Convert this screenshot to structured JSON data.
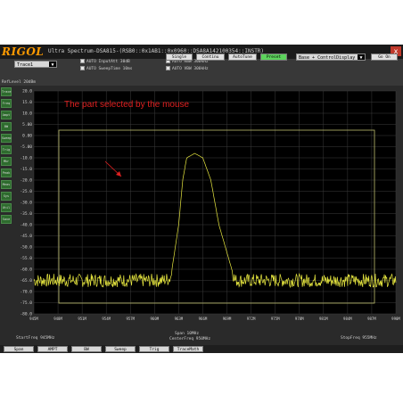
{
  "app": {
    "logo": "RIGOL",
    "title": "Ultra Spectrum-DSA815-(RSB0::0x1AB1::0x0960::DSA8A142100354::INSTR)",
    "close_label": "x"
  },
  "toolbar": {
    "trace_select": "Trace1",
    "buttons": [
      {
        "label": "Single",
        "active": false
      },
      {
        "label": "Continu",
        "active": false
      },
      {
        "label": "AutoTune",
        "active": false
      },
      {
        "label": "Preset",
        "active": true
      }
    ],
    "mode_select": "Base + ControlDisplay",
    "go_label": "Go On",
    "checks": [
      {
        "label": "AUTO InputAtt  30dB"
      },
      {
        "label": "AUTO SweepTime  10ms"
      },
      {
        "label": "AUTO RBW  300kHz"
      },
      {
        "label": "AUTO VBW  300kHz"
      }
    ]
  },
  "ref_level": "RefLevel  20dBm",
  "sidebar": {
    "items": [
      "Trace",
      "Freq",
      "Ampt",
      "BW",
      "Sweep",
      "Trig",
      "Mkr",
      "Peak",
      "Meas",
      "Sys",
      "Util",
      "Save"
    ]
  },
  "annotation": "The part selected by the mouse",
  "chart_data": {
    "type": "line",
    "title": "",
    "xlabel": "",
    "ylabel": "",
    "x_tick_labels": [
      "945M",
      "948M",
      "951M",
      "954M",
      "957M",
      "960M",
      "963M",
      "966M",
      "969M",
      "972M",
      "975M",
      "978M",
      "981M",
      "984M",
      "987M",
      "990M"
    ],
    "y_tick_labels": [
      "20.0",
      "15.0",
      "10.0",
      "5.00",
      "0.00",
      "-5.00",
      "-10.0",
      "-15.0",
      "-20.0",
      "-25.0",
      "-30.0",
      "-35.0",
      "-40.0",
      "-45.0",
      "-50.0",
      "-55.0",
      "-60.0",
      "-65.0",
      "-70.0",
      "-75.0",
      "-80.0"
    ],
    "ylim": [
      -80,
      20
    ],
    "grid": true,
    "noise_floor_dbm": -65,
    "series": [
      {
        "color": "#e8e840",
        "x_mhz": [
          945,
          950,
          955,
          960,
          961,
          962,
          963,
          963.5,
          964,
          965,
          966,
          967,
          968,
          970,
          975,
          980,
          985,
          990
        ],
        "y_dbm": [
          -65,
          -65,
          -65,
          -65,
          -65,
          -64,
          -40,
          -20,
          -10,
          -8,
          -10,
          -20,
          -40,
          -65,
          -65,
          -65,
          -65,
          -65
        ]
      }
    ]
  },
  "status": {
    "start_freq": "StartFreq  945MHz",
    "span": "Span  10MHz",
    "center_freq": "CenterFreq  950MHz",
    "stop_freq": "StopFreq  955MHz"
  },
  "bottom_buttons": [
    "Span",
    "AMPT",
    "BW",
    "Sweep",
    "Trig",
    "TraceMath"
  ],
  "colors": {
    "plot_bg": "#000000",
    "grid": "#3c3c3c",
    "trace": "#e8e840",
    "selection_box": "#bdbd6e",
    "annotation": "#e02020",
    "logo": "#ff9a00"
  }
}
